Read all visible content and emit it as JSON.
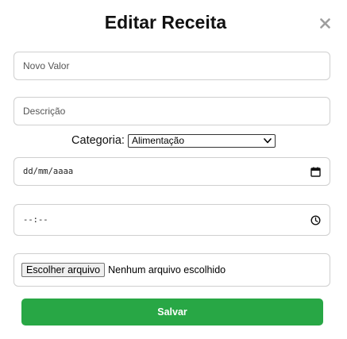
{
  "modal": {
    "title": "Editar Receita",
    "close_icon": "close-icon"
  },
  "form": {
    "value_placeholder": "Novo Valor",
    "description_placeholder": "Descrição",
    "category_label": "Categoria:",
    "category_selected": "Alimentação",
    "date_placeholder": "dd/mm/aaaa",
    "time_placeholder": "--:--",
    "file_button_label": "Escolher arquivo",
    "file_status": "Nenhum arquivo escolhido",
    "save_label": "Salvar"
  },
  "colors": {
    "save_button": "#28a745",
    "close_icon": "#9e9e9e"
  },
  "icons": [
    "close-icon",
    "chevron-down-icon",
    "calendar-icon",
    "clock-icon"
  ]
}
